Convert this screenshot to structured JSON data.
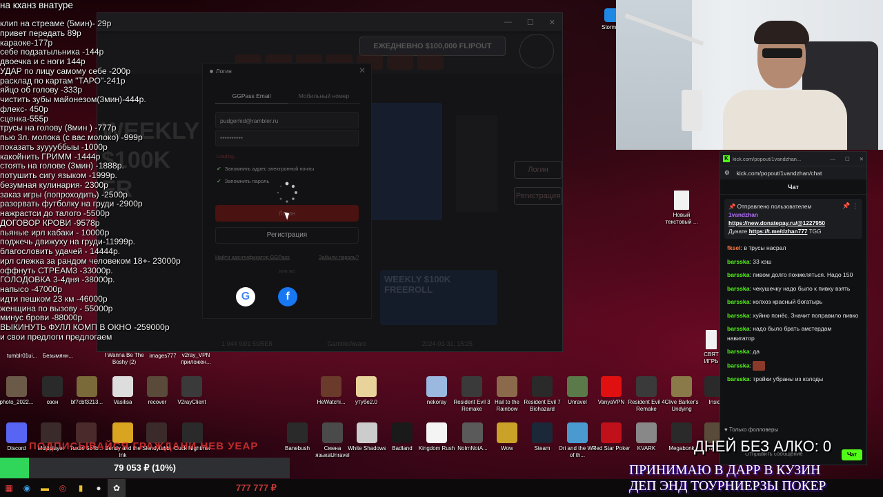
{
  "overlay": {
    "head": "на кханз внатуре",
    "items": [
      "клип на стреаме (5мин)- 29р",
      "привет передать 89р",
      "караоке-177р",
      "себе подзатыльника -144р",
      "двоечка и с ноги 144р",
      "УДАР по лицу самому себе -200р",
      "расклад по картам \"ТАРО\"-241р",
      "яйцо об голову -333р",
      "чистить зубы майонезом(3мин)-444р.",
      "флекс- 450р",
      "сценка-555р",
      "трусы на голову (8мин ) -777р",
      "пью 3л. молока (с вас молоко) -999р",
      "показать зууууббыы -1000р",
      "какойнить ГРИММ -1444р",
      "стоять на голове (3мин) -1888р.",
      "потушить сигу языком -1999р.",
      "безумная кулинария- 2300р",
      "заказ игры (попроходить) -2500р",
      "разорвать футболку на груди -2900р",
      "нажрастси до талого -5500р",
      "ДОГОВОР КРОВИ -9578р",
      "пьяные ирл кабаки - 10000р",
      "поджечь движуху на груди-11999р.",
      "благословить удачей - 14444р.",
      "ирл слежка за рандом человеком 18+- 23000р",
      "оффнуть СТРЕАМ3 -33000р.",
      "ГОЛОДОВКА 3-4дня -38000р.",
      "напысо -47000р",
      "идти пешком 23 км -46000р",
      "женщина по вызову - 55000р",
      "минус брови -88000р",
      "ВЫКИНУТЬ ФУЛЛ КОМП В ОКНО -259000р",
      "и свои предлоги предлогаем"
    ]
  },
  "casino": {
    "promo": "ЕЖЕДНЕВНО $100,000 FLIPOUT",
    "hero": "WEEKLY $100K FR",
    "side_login": "Логин",
    "side_register": "Регистрация",
    "freeroll": "WEEKLY $100K FREEROLL",
    "footer_left": "1 044 93/1 50/5E8",
    "footer_brand": "GambleAware",
    "footer_time": "2024-01-31, 15:25"
  },
  "login": {
    "title": "Логин",
    "tab_email": "GGPass Email",
    "tab_phone": "Мобильный номер",
    "email_value": "pudgemid@rambler.ru",
    "password_value": "**********",
    "loading": "Loading...",
    "remember_email": "Запомнить адрес электронной почты",
    "remember_password": "Запомнить пароль",
    "login_button": "Логин",
    "register_button": "Регистрация",
    "find_id": "Найти идентификатор GGPass",
    "forgot_password": "Забыли пароль?",
    "or": "или же"
  },
  "desktop": {
    "top_right_icon": "Stormfo",
    "text_doc": "Новый текстовый ...",
    "right_edge": "СВЯТ ИГРЬ",
    "row1_labels": [
      "tumblr01ui...",
      "Безымянн...",
      "I Wanna Be The Boshy (2)",
      "images777",
      "v2ray_VPN приложен..."
    ],
    "row2": [
      {
        "label": "photo_2022...",
        "color": "#6b5a48"
      },
      {
        "label": "озон",
        "color": "#2a2a2a"
      },
      {
        "label": "bf7cbf3213...",
        "color": "#7a6a3a"
      },
      {
        "label": "Vasilisa",
        "color": "#dddddd"
      },
      {
        "label": "recover",
        "color": "#5a4a3a"
      },
      {
        "label": "V2rayClient",
        "color": "#3a3a3a"
      },
      {
        "label": "HeWatchi...",
        "color": "#6a3a2a"
      },
      {
        "label": "утубе2.0",
        "color": "#e8d39a"
      },
      {
        "label": "nekoray",
        "color": "#9ab8e0"
      },
      {
        "label": "Resident Evil 3 Remake",
        "color": "#3a3a3a"
      },
      {
        "label": "Hail to the Rainbow",
        "color": "#8a6a4a"
      },
      {
        "label": "Resident Evil 7 Biohazard",
        "color": "#2a2a2a"
      },
      {
        "label": "Unravel",
        "color": "#5a7a4a"
      },
      {
        "label": "VanyaVPN",
        "color": "#e01010"
      },
      {
        "label": "Resident Evil 4 Remake",
        "color": "#3a3a3a"
      },
      {
        "label": "Clive Barker's Undying",
        "color": "#8a7a4a"
      },
      {
        "label": "Insid",
        "color": "#2a2a2a"
      }
    ],
    "row3": [
      {
        "label": "Discord",
        "color": "#5865f2"
      },
      {
        "label": "Multiplayer",
        "color": "#3a2a2a"
      },
      {
        "label": "Tuxbe 5c4b...",
        "color": "#4a2a2a"
      },
      {
        "label": "Bendy and the Ink",
        "color": "#d9a520"
      },
      {
        "label": "Slendytubbi",
        "color": "#3a2a2a"
      },
      {
        "label": "Cuck Nightmer",
        "color": "#2a2a2a"
      },
      {
        "label": "Banebush",
        "color": "#2a2a2a"
      },
      {
        "label": "Смена языкаUnravel",
        "color": "#4a4a4a"
      },
      {
        "label": "White Shadows",
        "color": "#cccccc"
      },
      {
        "label": "Badland",
        "color": "#1a1a1a"
      },
      {
        "label": "Kingdom Rush",
        "color": "#f4f4f4"
      },
      {
        "label": "NoImNotA...",
        "color": "#5a5a5a"
      },
      {
        "label": "Wow",
        "color": "#c9a227"
      },
      {
        "label": "Steam",
        "color": "#1b2838"
      },
      {
        "label": "Ori and the Will of th...",
        "color": "#4a9ad0"
      },
      {
        "label": "Red Star Poker",
        "color": "#c0101a"
      },
      {
        "label": "KVARK",
        "color": "#888888"
      },
      {
        "label": "Megabonk",
        "color": "#2a2a2a"
      },
      {
        "label": "The Bo",
        "color": "#5a4a3a"
      }
    ]
  },
  "chat": {
    "window_url_title": "kick.com/popout/1vandzhan...",
    "url": "kick.com/popout/1vandzhan/chat",
    "header": "Чат",
    "pinned_label": "Отправлено пользователем",
    "pinned_user": "1vandzhan",
    "pinned_link1": "https://new.donatepay.ru/@1227950",
    "pinned_text2_prefix": "Дунате",
    "pinned_link2": "https://t.me/dzhan777",
    "pinned_text2_suffix": "TGG",
    "messages": [
      {
        "user": "fksel",
        "text": ": в трусы насрал",
        "orange": true
      },
      {
        "user": "barsska",
        "text": ": 33 кэш",
        "orange": false
      },
      {
        "user": "barsska",
        "text": ": пивом долго похмеляться. Надо 150",
        "orange": false
      },
      {
        "user": "barsska",
        "text": ": чекушечку надо было к пивку взять",
        "orange": false
      },
      {
        "user": "barsska",
        "text": ": колхоз красный богатырь",
        "orange": false
      },
      {
        "user": "barsska",
        "text": ": хуйню понёс. Значит поправило пивко",
        "orange": false
      },
      {
        "user": "barsska",
        "text": ": надо было брать амстердам навигатор",
        "orange": false
      },
      {
        "user": "barsska",
        "text": ": да",
        "orange": false
      },
      {
        "user": "barsska",
        "text": ":",
        "orange": false
      },
      {
        "user": "barsska",
        "text": ": тройки убраны из колоды",
        "orange": false
      }
    ],
    "followers": "Только фолловеры",
    "input_placeholder": "Отправить сообщение",
    "send": "Чат"
  },
  "progress": {
    "text": "79 053 ₽ (10%)",
    "fraction": 0.1
  },
  "subscribe": "ПОДПИСЫВАЙСЯ ГРАЖДАНИ НЕВ УЕАР",
  "days_counter": "ДНЕЙ БЕЗ АЛКО: 0",
  "accept_line1": "ПРИНИМАЮ В ДАРР В КУЗИН",
  "accept_line2": "ДЕП ЭНД ТОУРНИЕРЗЫ ПОКЕР",
  "taskbar_amount": "777 777 ₽"
}
